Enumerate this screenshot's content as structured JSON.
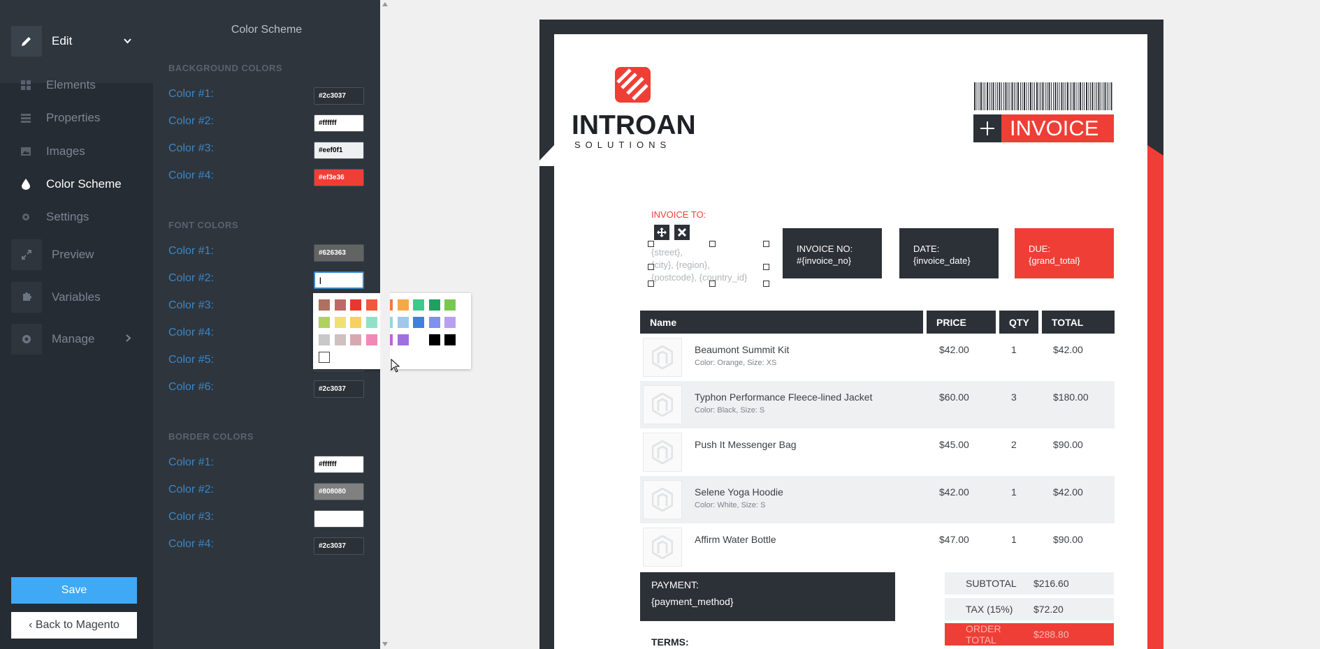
{
  "sidebar": {
    "edit_label": "Edit",
    "items": [
      {
        "label": "Elements",
        "icon": "grid-icon"
      },
      {
        "label": "Properties",
        "icon": "layers-icon"
      },
      {
        "label": "Images",
        "icon": "image-icon"
      },
      {
        "label": "Color Scheme",
        "icon": "droplet-icon"
      },
      {
        "label": "Settings",
        "icon": "gear-icon"
      }
    ],
    "preview_label": "Preview",
    "variables_label": "Variables",
    "manage_label": "Manage",
    "save_label": "Save",
    "back_label": "Back to Magento"
  },
  "panel": {
    "title": "Color Scheme",
    "background": {
      "title": "BACKGROUND COLORS",
      "colors": [
        {
          "label": "Color #1:",
          "value": "#2c3037"
        },
        {
          "label": "Color #2:",
          "value": "#ffffff"
        },
        {
          "label": "Color #3:",
          "value": "#eef0f1"
        },
        {
          "label": "Color #4:",
          "value": "#ef3e36"
        }
      ]
    },
    "font": {
      "title": "FONT COLORS",
      "colors": [
        {
          "label": "Color #1:",
          "value": "#626363"
        },
        {
          "label": "Color #2:",
          "value": "|"
        },
        {
          "label": "Color #3:",
          "value": ""
        },
        {
          "label": "Color #4:",
          "value": ""
        },
        {
          "label": "Color #5:",
          "value": ""
        },
        {
          "label": "Color #6:",
          "value": "#2c3037"
        }
      ]
    },
    "border": {
      "title": "BORDER COLORS",
      "colors": [
        {
          "label": "Color #1:",
          "value": "#ffffff"
        },
        {
          "label": "Color #2:",
          "value": "#808080"
        },
        {
          "label": "Color #3:",
          "value": ""
        },
        {
          "label": "Color #4:",
          "value": "#2c3037"
        }
      ]
    }
  },
  "picker_colors": [
    [
      "#b07060",
      "#c06868",
      "#e8382e",
      "#ef5a3a",
      "#f07a3c",
      "#f5a84a",
      "#3ec88a",
      "#20a060",
      "#78c850"
    ],
    [
      "#b0d060",
      "#f0e070",
      "#f8d060",
      "#90e0c8",
      "#90d8e0",
      "#a0c8e8",
      "#4080e0",
      "#8090f0",
      "#b8a0f0"
    ],
    [
      "#c8c8c8",
      "#d0c0c0",
      "#d8a8b0",
      "#f088b8",
      "#c060e0",
      "#a070e0",
      "",
      "#000000",
      "#000000"
    ]
  ],
  "invoice": {
    "company": "INTROAN",
    "company_sub": "SOLUTIONS",
    "badge": "INVOICE",
    "invoice_to": "INVOICE TO:",
    "address": [
      "{street},",
      "{city}, {region},",
      "{postcode}, {country_id}"
    ],
    "boxes": [
      {
        "label": "INVOICE NO:",
        "value": "#{invoice_no}"
      },
      {
        "label": "DATE:",
        "value": "{invoice_date}"
      },
      {
        "label": "DUE:",
        "value": "{grand_total}"
      }
    ],
    "columns": [
      "Name",
      "PRICE",
      "QTY",
      "TOTAL"
    ],
    "items": [
      {
        "name": "Beaumont Summit Kit",
        "options": "Color: Orange, Size: XS",
        "price": "$42.00",
        "qty": "1",
        "total": "$42.00"
      },
      {
        "name": "Typhon Performance Fleece-lined Jacket",
        "options": "Color: Black, Size: S",
        "price": "$60.00",
        "qty": "3",
        "total": "$180.00"
      },
      {
        "name": "Push It Messenger Bag",
        "options": "",
        "price": "$45.00",
        "qty": "2",
        "total": "$90.00"
      },
      {
        "name": "Selene Yoga Hoodie",
        "options": "Color: White, Size: S",
        "price": "$42.00",
        "qty": "1",
        "total": "$42.00"
      },
      {
        "name": "Affirm Water Bottle",
        "options": "",
        "price": "$47.00",
        "qty": "1",
        "total": "$90.00"
      }
    ],
    "payment_label": "PAYMENT:",
    "payment_value": "{payment_method}",
    "totals": [
      {
        "label": "SUBTOTAL",
        "value": "$216.60"
      },
      {
        "label": "TAX (15%)",
        "value": "$72.20"
      },
      {
        "label": "ORDER TOTAL",
        "value": "$288.80"
      }
    ],
    "terms": "TERMS:"
  }
}
